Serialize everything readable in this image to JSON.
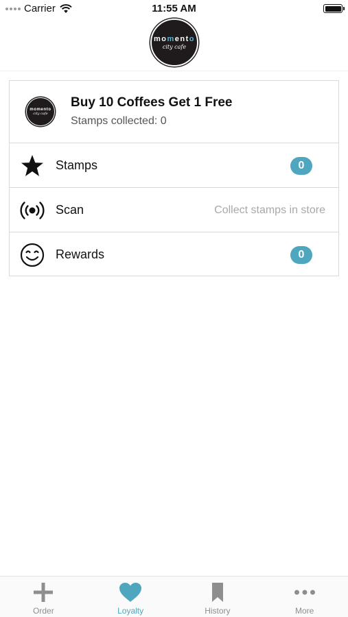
{
  "status_bar": {
    "carrier": "Carrier",
    "time": "11:55 AM"
  },
  "header": {
    "logo_main": "momento",
    "logo_sub": "city cafe"
  },
  "card": {
    "title": "Buy 10 Coffees Get 1 Free",
    "subtitle": "Stamps collected: 0",
    "rows": [
      {
        "label": "Stamps",
        "badge": "0",
        "icon": "star-icon"
      },
      {
        "label": "Scan",
        "hint": "Collect stamps in store",
        "icon": "broadcast-icon"
      },
      {
        "label": "Rewards",
        "badge": "0",
        "icon": "smiley-icon"
      }
    ]
  },
  "tabbar": {
    "active_color": "#4ea6bf",
    "tabs": [
      {
        "label": "Order",
        "icon": "plus-icon"
      },
      {
        "label": "Loyalty",
        "icon": "heart-icon"
      },
      {
        "label": "History",
        "icon": "bookmark-icon"
      },
      {
        "label": "More",
        "icon": "more-icon"
      }
    ]
  }
}
